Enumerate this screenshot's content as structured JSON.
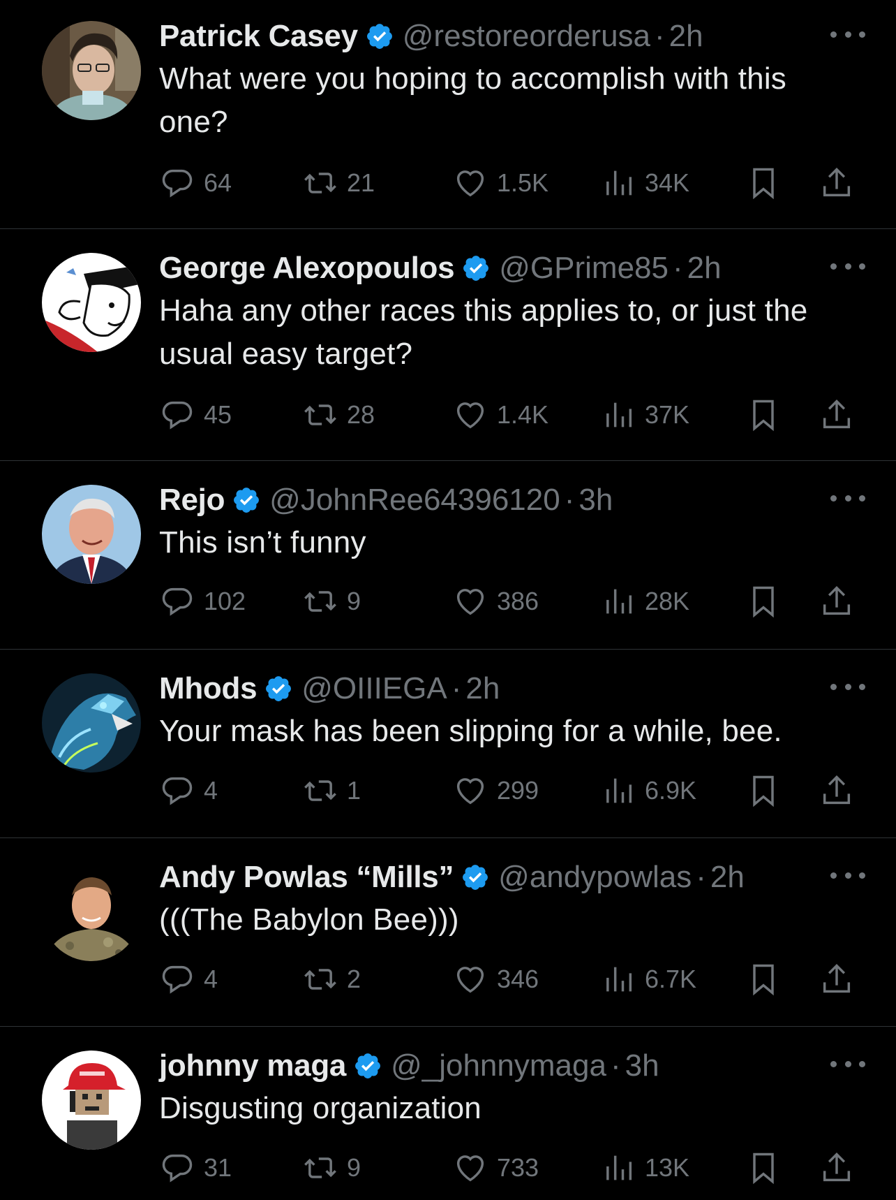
{
  "colors": {
    "background": "#000000",
    "text": "#e7e9ea",
    "muted": "#71767b",
    "verified": "#1d9bf0",
    "divider": "#2f3336"
  },
  "separator": "·",
  "tweets": [
    {
      "name": "Patrick Casey",
      "handle": "@restoreorderusa",
      "time": "2h",
      "text": "What were you hoping to accomplish with this one?",
      "replies": "64",
      "retweets": "21",
      "likes": "1.5K",
      "views": "34K",
      "avatar": "man-with-glasses-photo"
    },
    {
      "name": "George Alexopoulos",
      "handle": "@GPrime85",
      "time": "2h",
      "text": "Haha any other races this applies to, or just the usual easy target?",
      "replies": "45",
      "retweets": "28",
      "likes": "1.4K",
      "views": "37K",
      "avatar": "cartoon-man-hat"
    },
    {
      "name": "Rejo",
      "handle": "@JohnRee64396120",
      "time": "3h",
      "text": "This isn’t funny",
      "replies": "102",
      "retweets": "9",
      "likes": "386",
      "views": "28K",
      "avatar": "man-in-suit-photo"
    },
    {
      "name": "Mhods",
      "handle": "@OIIIEGA",
      "time": "2h",
      "text": "Your mask has been slipping for a while, bee.",
      "replies": "4",
      "retweets": "1",
      "likes": "299",
      "views": "6.9K",
      "avatar": "blue-werewolf-art"
    },
    {
      "name": "Andy Powlas “Mills”",
      "handle": "@andypowlas",
      "time": "2h",
      "text": "(((The Babylon Bee)))",
      "replies": "4",
      "retweets": "2",
      "likes": "346",
      "views": "6.7K",
      "avatar": "soldier-photo"
    },
    {
      "name": "johnny maga",
      "handle": "@_johnnymaga",
      "time": "3h",
      "text": "Disgusting organization",
      "replies": "31",
      "retweets": "9",
      "likes": "733",
      "views": "13K",
      "avatar": "pixel-art-red-cap"
    }
  ]
}
